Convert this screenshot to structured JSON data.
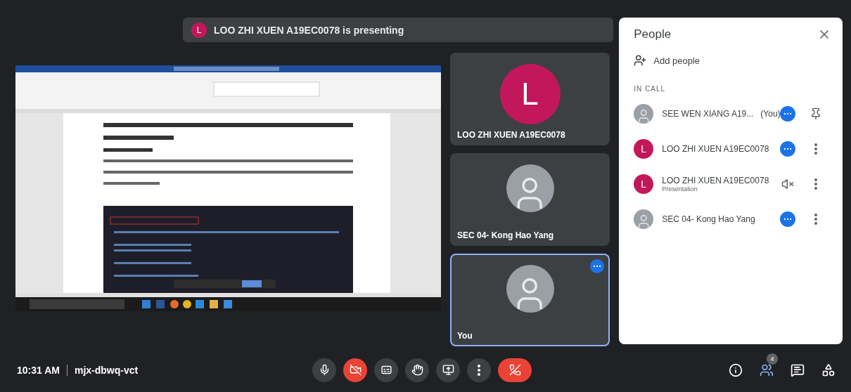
{
  "banner": {
    "avatar_letter": "L",
    "text": "LOO ZHI XUEN A19EC0078 is presenting"
  },
  "tiles": [
    {
      "name": "LOO ZHI XUEN A19EC0078",
      "avatar": {
        "kind": "letter",
        "letter": "L"
      },
      "selected": false
    },
    {
      "name": "SEC 04- Kong Hao Yang",
      "avatar": {
        "kind": "photo"
      },
      "selected": false
    },
    {
      "name": "You",
      "avatar": {
        "kind": "photo"
      },
      "selected": true
    }
  ],
  "people": {
    "title": "People",
    "add_label": "Add people",
    "section": "IN CALL",
    "participants": [
      {
        "name": "SEE WEN XIANG A19...",
        "tag": "(You)",
        "avatar": {
          "kind": "photo"
        },
        "status": {
          "kind": "more"
        },
        "trailing": {
          "kind": "pin"
        }
      },
      {
        "name": "LOO ZHI XUEN A19EC0078",
        "avatar": {
          "kind": "letter",
          "letter": "L"
        },
        "status": {
          "kind": "more"
        },
        "trailing": {
          "kind": "menu"
        }
      },
      {
        "name": "LOO ZHI XUEN A19EC0078",
        "subtitle": "Presentation",
        "avatar": {
          "kind": "letter",
          "letter": "L"
        },
        "status": {
          "kind": "muted"
        },
        "trailing": {
          "kind": "menu"
        }
      },
      {
        "name": "SEC 04- Kong Hao Yang",
        "avatar": {
          "kind": "photo"
        },
        "status": {
          "kind": "more"
        },
        "trailing": {
          "kind": "menu"
        }
      }
    ]
  },
  "meeting": {
    "time": "10:31 AM",
    "code": "mjx-dbwq-vct"
  },
  "controls": [
    {
      "kind": "mic",
      "on": true
    },
    {
      "kind": "camera",
      "on": false
    },
    {
      "kind": "captions"
    },
    {
      "kind": "hand"
    },
    {
      "kind": "present"
    },
    {
      "kind": "more"
    },
    {
      "kind": "leave"
    }
  ],
  "side_buttons": [
    {
      "kind": "info",
      "selected": false
    },
    {
      "kind": "people",
      "selected": true,
      "badge": "4"
    },
    {
      "kind": "chat",
      "selected": false
    },
    {
      "kind": "activities",
      "selected": false
    }
  ]
}
